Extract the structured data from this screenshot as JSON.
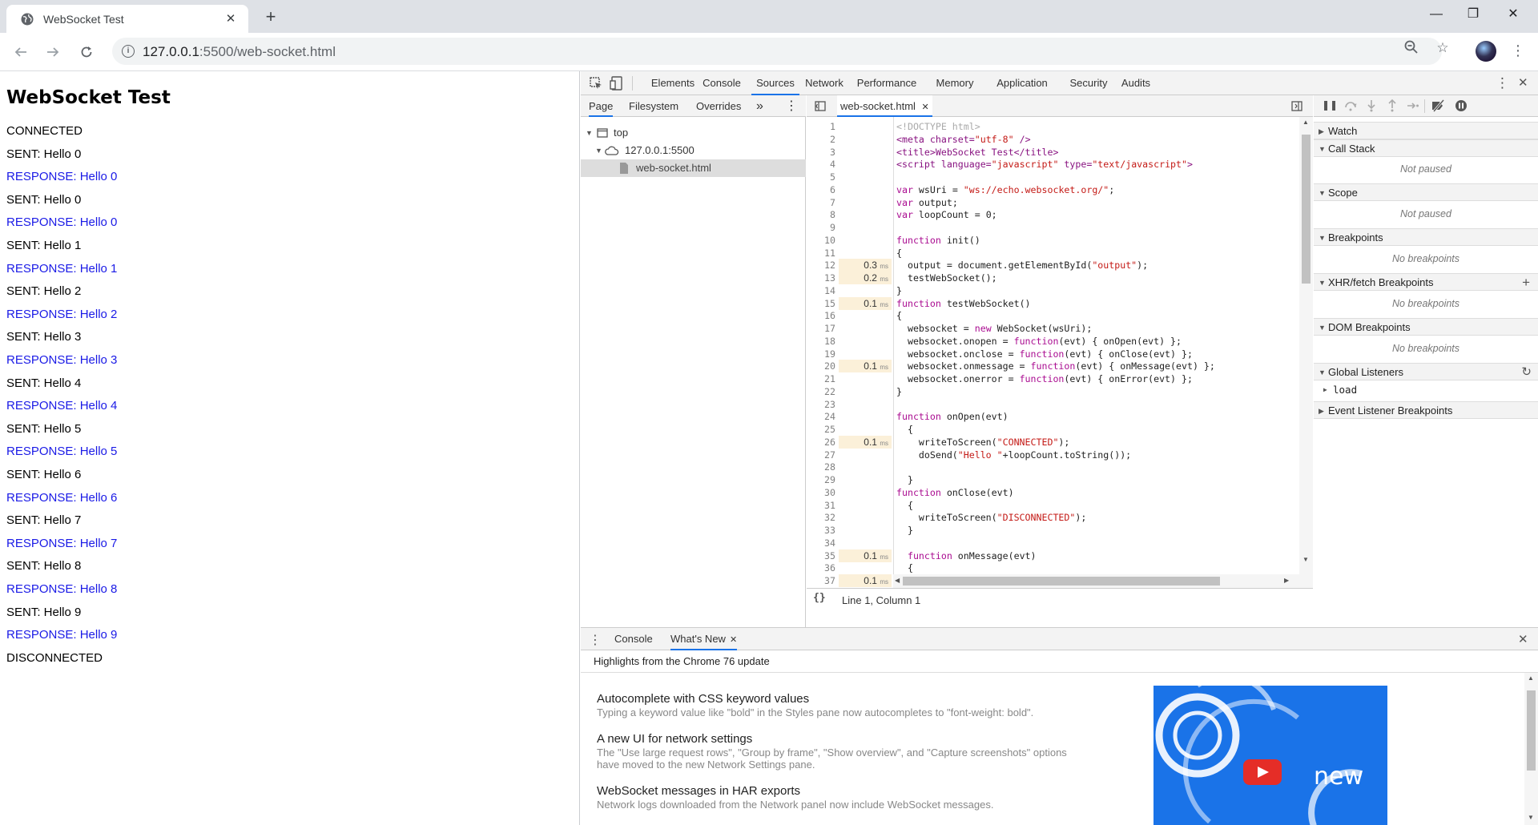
{
  "browser": {
    "tab_title": "WebSocket Test",
    "tab_close": "✕",
    "new_tab": "+",
    "url_host": "127.0.0.1",
    "url_rest": ":5500/web-socket.html",
    "window_controls": {
      "minimize": "—",
      "restore": "❐",
      "close": "✕"
    }
  },
  "page": {
    "heading": "WebSocket Test",
    "lines": [
      {
        "text": "CONNECTED",
        "kind": "plain"
      },
      {
        "text": "SENT: Hello 0",
        "kind": "plain"
      },
      {
        "text": "RESPONSE: Hello 0",
        "kind": "resp"
      },
      {
        "text": "SENT: Hello 0",
        "kind": "plain"
      },
      {
        "text": "RESPONSE: Hello 0",
        "kind": "resp"
      },
      {
        "text": "SENT: Hello 1",
        "kind": "plain"
      },
      {
        "text": "RESPONSE: Hello 1",
        "kind": "resp"
      },
      {
        "text": "SENT: Hello 2",
        "kind": "plain"
      },
      {
        "text": "RESPONSE: Hello 2",
        "kind": "resp"
      },
      {
        "text": "SENT: Hello 3",
        "kind": "plain"
      },
      {
        "text": "RESPONSE: Hello 3",
        "kind": "resp"
      },
      {
        "text": "SENT: Hello 4",
        "kind": "plain"
      },
      {
        "text": "RESPONSE: Hello 4",
        "kind": "resp"
      },
      {
        "text": "SENT: Hello 5",
        "kind": "plain"
      },
      {
        "text": "RESPONSE: Hello 5",
        "kind": "resp"
      },
      {
        "text": "SENT: Hello 6",
        "kind": "plain"
      },
      {
        "text": "RESPONSE: Hello 6",
        "kind": "resp"
      },
      {
        "text": "SENT: Hello 7",
        "kind": "plain"
      },
      {
        "text": "RESPONSE: Hello 7",
        "kind": "resp"
      },
      {
        "text": "SENT: Hello 8",
        "kind": "plain"
      },
      {
        "text": "RESPONSE: Hello 8",
        "kind": "resp"
      },
      {
        "text": "SENT: Hello 9",
        "kind": "plain"
      },
      {
        "text": "RESPONSE: Hello 9",
        "kind": "resp"
      },
      {
        "text": "DISCONNECTED",
        "kind": "plain"
      }
    ]
  },
  "devtools": {
    "tabs": [
      "Elements",
      "Console",
      "Sources",
      "Network",
      "Performance",
      "Memory",
      "Application",
      "Security",
      "Audits"
    ],
    "active_tab": "Sources",
    "navigator_tabs": [
      "Page",
      "Filesystem",
      "Overrides"
    ],
    "more_tabs": "»",
    "tree": {
      "top": "top",
      "host": "127.0.0.1:5500",
      "file": "web-socket.html"
    },
    "editor_tab": "web-socket.html",
    "status": "Line 1, Column 1",
    "code": [
      {
        "n": "1",
        "t": "",
        "code": "<!DOCTYPE html>",
        "dim": true
      },
      {
        "n": "2",
        "t": "",
        "code": "<meta charset=\"utf-8\" />"
      },
      {
        "n": "3",
        "t": "",
        "code": "<title>WebSocket Test</title>"
      },
      {
        "n": "4",
        "t": "",
        "code": "<script language=\"javascript\" type=\"text/javascript\">"
      },
      {
        "n": "5",
        "t": "",
        "code": ""
      },
      {
        "n": "6",
        "t": "",
        "code": "var wsUri = \"ws://echo.websocket.org/\";"
      },
      {
        "n": "7",
        "t": "",
        "code": "var output;"
      },
      {
        "n": "8",
        "t": "",
        "code": "var loopCount = 0;"
      },
      {
        "n": "9",
        "t": "",
        "code": ""
      },
      {
        "n": "10",
        "t": "",
        "code": "function init()"
      },
      {
        "n": "11",
        "t": "",
        "code": "{"
      },
      {
        "n": "12",
        "t": "0.3",
        "code": "  output = document.getElementById(\"output\");"
      },
      {
        "n": "13",
        "t": "0.2",
        "code": "  testWebSocket();"
      },
      {
        "n": "14",
        "t": "",
        "code": "}"
      },
      {
        "n": "15",
        "t": "0.1",
        "code": "function testWebSocket()"
      },
      {
        "n": "16",
        "t": "",
        "code": "{"
      },
      {
        "n": "17",
        "t": "",
        "code": "  websocket = new WebSocket(wsUri);"
      },
      {
        "n": "18",
        "t": "",
        "code": "  websocket.onopen = function(evt) { onOpen(evt) };"
      },
      {
        "n": "19",
        "t": "",
        "code": "  websocket.onclose = function(evt) { onClose(evt) };"
      },
      {
        "n": "20",
        "t": "0.1",
        "code": "  websocket.onmessage = function(evt) { onMessage(evt) };"
      },
      {
        "n": "21",
        "t": "",
        "code": "  websocket.onerror = function(evt) { onError(evt) };"
      },
      {
        "n": "22",
        "t": "",
        "code": "}"
      },
      {
        "n": "23",
        "t": "",
        "code": ""
      },
      {
        "n": "24",
        "t": "",
        "code": "function onOpen(evt)"
      },
      {
        "n": "25",
        "t": "",
        "code": "  {"
      },
      {
        "n": "26",
        "t": "0.1",
        "code": "    writeToScreen(\"CONNECTED\");"
      },
      {
        "n": "27",
        "t": "",
        "code": "    doSend(\"Hello \"+loopCount.toString());"
      },
      {
        "n": "28",
        "t": "",
        "code": ""
      },
      {
        "n": "29",
        "t": "",
        "code": "  }"
      },
      {
        "n": "30",
        "t": "",
        "code": "function onClose(evt)"
      },
      {
        "n": "31",
        "t": "",
        "code": "  {"
      },
      {
        "n": "32",
        "t": "",
        "code": "    writeToScreen(\"DISCONNECTED\");"
      },
      {
        "n": "33",
        "t": "",
        "code": "  }"
      },
      {
        "n": "34",
        "t": "",
        "code": ""
      },
      {
        "n": "35",
        "t": "0.1",
        "code": "  function onMessage(evt)"
      },
      {
        "n": "36",
        "t": "",
        "code": "  {"
      },
      {
        "n": "37",
        "t": "0.1",
        "code": ""
      }
    ],
    "time_unit": "ms",
    "sidebar": {
      "watch": "Watch",
      "call_stack": "Call Stack",
      "not_paused_1": "Not paused",
      "scope": "Scope",
      "not_paused_2": "Not paused",
      "breakpoints": "Breakpoints",
      "no_breakpoints_1": "No breakpoints",
      "xhr": "XHR/fetch Breakpoints",
      "no_breakpoints_2": "No breakpoints",
      "dom": "DOM Breakpoints",
      "no_breakpoints_3": "No breakpoints",
      "global": "Global Listeners",
      "load": "load",
      "event": "Event Listener Breakpoints"
    },
    "drawer": {
      "tabs": [
        "Console",
        "What's New"
      ],
      "highlights": "Highlights from the Chrome 76 update",
      "news": [
        {
          "title": "Autocomplete with CSS keyword values",
          "desc": "Typing a keyword value like \"bold\" in the Styles pane now autocompletes to \"font-weight: bold\"."
        },
        {
          "title": "A new UI for network settings",
          "desc": "The \"Use large request rows\", \"Group by frame\", \"Show overview\", and \"Capture screenshots\" options have moved to the new Network Settings pane."
        },
        {
          "title": "WebSocket messages in HAR exports",
          "desc": "Network logs downloaded from the Network panel now include WebSocket messages."
        }
      ],
      "promo_text": "new"
    }
  }
}
